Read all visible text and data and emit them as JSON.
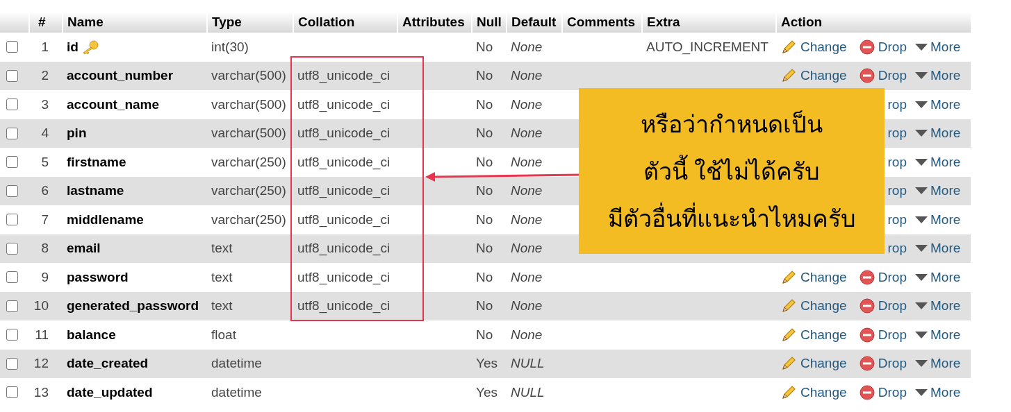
{
  "table": {
    "columns": [
      "#",
      "Name",
      "Type",
      "Collation",
      "Attributes",
      "Null",
      "Default",
      "Comments",
      "Extra",
      "Action"
    ],
    "rows": [
      {
        "checked": false,
        "num": "1",
        "name": "id",
        "primary_key": true,
        "type": "int(30)",
        "null": "No",
        "default": "None",
        "extra": "AUTO_INCREMENT",
        "actions": {
          "change": "Change",
          "drop": "Drop",
          "more": "More"
        }
      },
      {
        "checked": false,
        "num": "2",
        "name": "account_number",
        "primary_key": false,
        "type": "varchar(500)",
        "collation": "utf8_unicode_ci",
        "null": "No",
        "default": "None",
        "actions": {
          "change": "Change",
          "drop": "Drop",
          "more": "More"
        }
      },
      {
        "checked": false,
        "num": "3",
        "name": "account_name",
        "primary_key": false,
        "type": "varchar(500)",
        "collation": "utf8_unicode_ci",
        "null": "No",
        "default": "None",
        "actions": {
          "drop": "rop",
          "more": "More"
        }
      },
      {
        "checked": false,
        "num": "4",
        "name": "pin",
        "primary_key": false,
        "type": "varchar(500)",
        "collation": "utf8_unicode_ci",
        "null": "No",
        "default": "None",
        "actions": {
          "drop": "rop",
          "more": "More"
        }
      },
      {
        "checked": false,
        "num": "5",
        "name": "firstname",
        "primary_key": false,
        "type": "varchar(250)",
        "collation": "utf8_unicode_ci",
        "null": "No",
        "default": "None",
        "actions": {
          "drop": "rop",
          "more": "More"
        }
      },
      {
        "checked": false,
        "num": "6",
        "name": "lastname",
        "primary_key": false,
        "type": "varchar(250)",
        "collation": "utf8_unicode_ci",
        "null": "No",
        "default": "None",
        "actions": {
          "drop": "rop",
          "more": "More"
        }
      },
      {
        "checked": false,
        "num": "7",
        "name": "middlename",
        "primary_key": false,
        "type": "varchar(250)",
        "collation": "utf8_unicode_ci",
        "null": "No",
        "default": "None",
        "actions": {
          "drop": "rop",
          "more": "More"
        }
      },
      {
        "checked": false,
        "num": "8",
        "name": "email",
        "primary_key": false,
        "type": "text",
        "collation": "utf8_unicode_ci",
        "null": "No",
        "default": "None",
        "actions": {
          "drop": "rop",
          "more": "More"
        }
      },
      {
        "checked": false,
        "num": "9",
        "name": "password",
        "primary_key": false,
        "type": "text",
        "collation": "utf8_unicode_ci",
        "null": "No",
        "default": "None",
        "actions": {
          "change": "Change",
          "drop": "Drop",
          "more": "More"
        }
      },
      {
        "checked": false,
        "num": "10",
        "name": "generated_password",
        "primary_key": false,
        "type": "text",
        "collation": "utf8_unicode_ci",
        "null": "No",
        "default": "None",
        "actions": {
          "change": "Change",
          "drop": "Drop",
          "more": "More"
        }
      },
      {
        "checked": false,
        "num": "11",
        "name": "balance",
        "primary_key": false,
        "type": "float",
        "null": "No",
        "default": "None",
        "actions": {
          "change": "Change",
          "drop": "Drop",
          "more": "More"
        }
      },
      {
        "checked": false,
        "num": "12",
        "name": "date_created",
        "primary_key": false,
        "type": "datetime",
        "null": "Yes",
        "default": "NULL",
        "actions": {
          "change": "Change",
          "drop": "Drop",
          "more": "More"
        }
      },
      {
        "checked": false,
        "num": "13",
        "name": "date_updated",
        "primary_key": false,
        "type": "datetime",
        "null": "Yes",
        "default": "NULL",
        "actions": {
          "change": "Change",
          "drop": "Drop",
          "more": "More"
        }
      }
    ]
  },
  "callout": {
    "text": "หรือว่ากำหนดเป็น\nตัวนี้ ใช้ไม่ได้ครับ\nมีตัวอื่นที่แนะนำไหมครับ"
  }
}
